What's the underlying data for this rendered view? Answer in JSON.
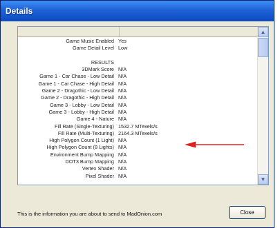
{
  "window": {
    "title": "Details"
  },
  "list": {
    "rows": [
      {
        "label": "Game Music Enabled",
        "value": "Yes"
      },
      {
        "label": "Game Detail Level",
        "value": "Low"
      },
      {
        "label": "",
        "value": ""
      },
      {
        "label": "RESULTS",
        "value": ""
      },
      {
        "label": "3DMark Score",
        "value": "N/A"
      },
      {
        "label": "Game 1 - Car Chase - Low Detail",
        "value": "N/A"
      },
      {
        "label": "Game 1 - Car Chase - High Detail",
        "value": "N/A"
      },
      {
        "label": "Game 2 - Dragothic - Low Detail",
        "value": "N/A"
      },
      {
        "label": "Game 2 - Dragothic - High Detail",
        "value": "N/A"
      },
      {
        "label": "Game 3 - Lobby - Low Detail",
        "value": "N/A"
      },
      {
        "label": "Game 3 - Lobby - High Detail",
        "value": "N/A"
      },
      {
        "label": "Game 4 - Nature",
        "value": "N/A"
      },
      {
        "label": "Fill Rate (Single-Texturing)",
        "value": "1532.7 MTexels/s"
      },
      {
        "label": "Fill Rate (Multi-Texturing)",
        "value": "2164.3 MTexels/s"
      },
      {
        "label": "High Polygon Count (1 Light)",
        "value": "N/A"
      },
      {
        "label": "High Polygon Count (8 Lights)",
        "value": "N/A"
      },
      {
        "label": "Environment Bump Mapping",
        "value": "N/A"
      },
      {
        "label": "DOT3 Bump Mapping",
        "value": "N/A"
      },
      {
        "label": "Vertex Shader",
        "value": "N/A"
      },
      {
        "label": "Pixel Shader",
        "value": "N/A"
      }
    ]
  },
  "annotation": {
    "arrow_color": "#e0201c"
  },
  "footer": {
    "info_text": "This is the information you are about to send to MadOnion.com",
    "close_label": "Close"
  }
}
